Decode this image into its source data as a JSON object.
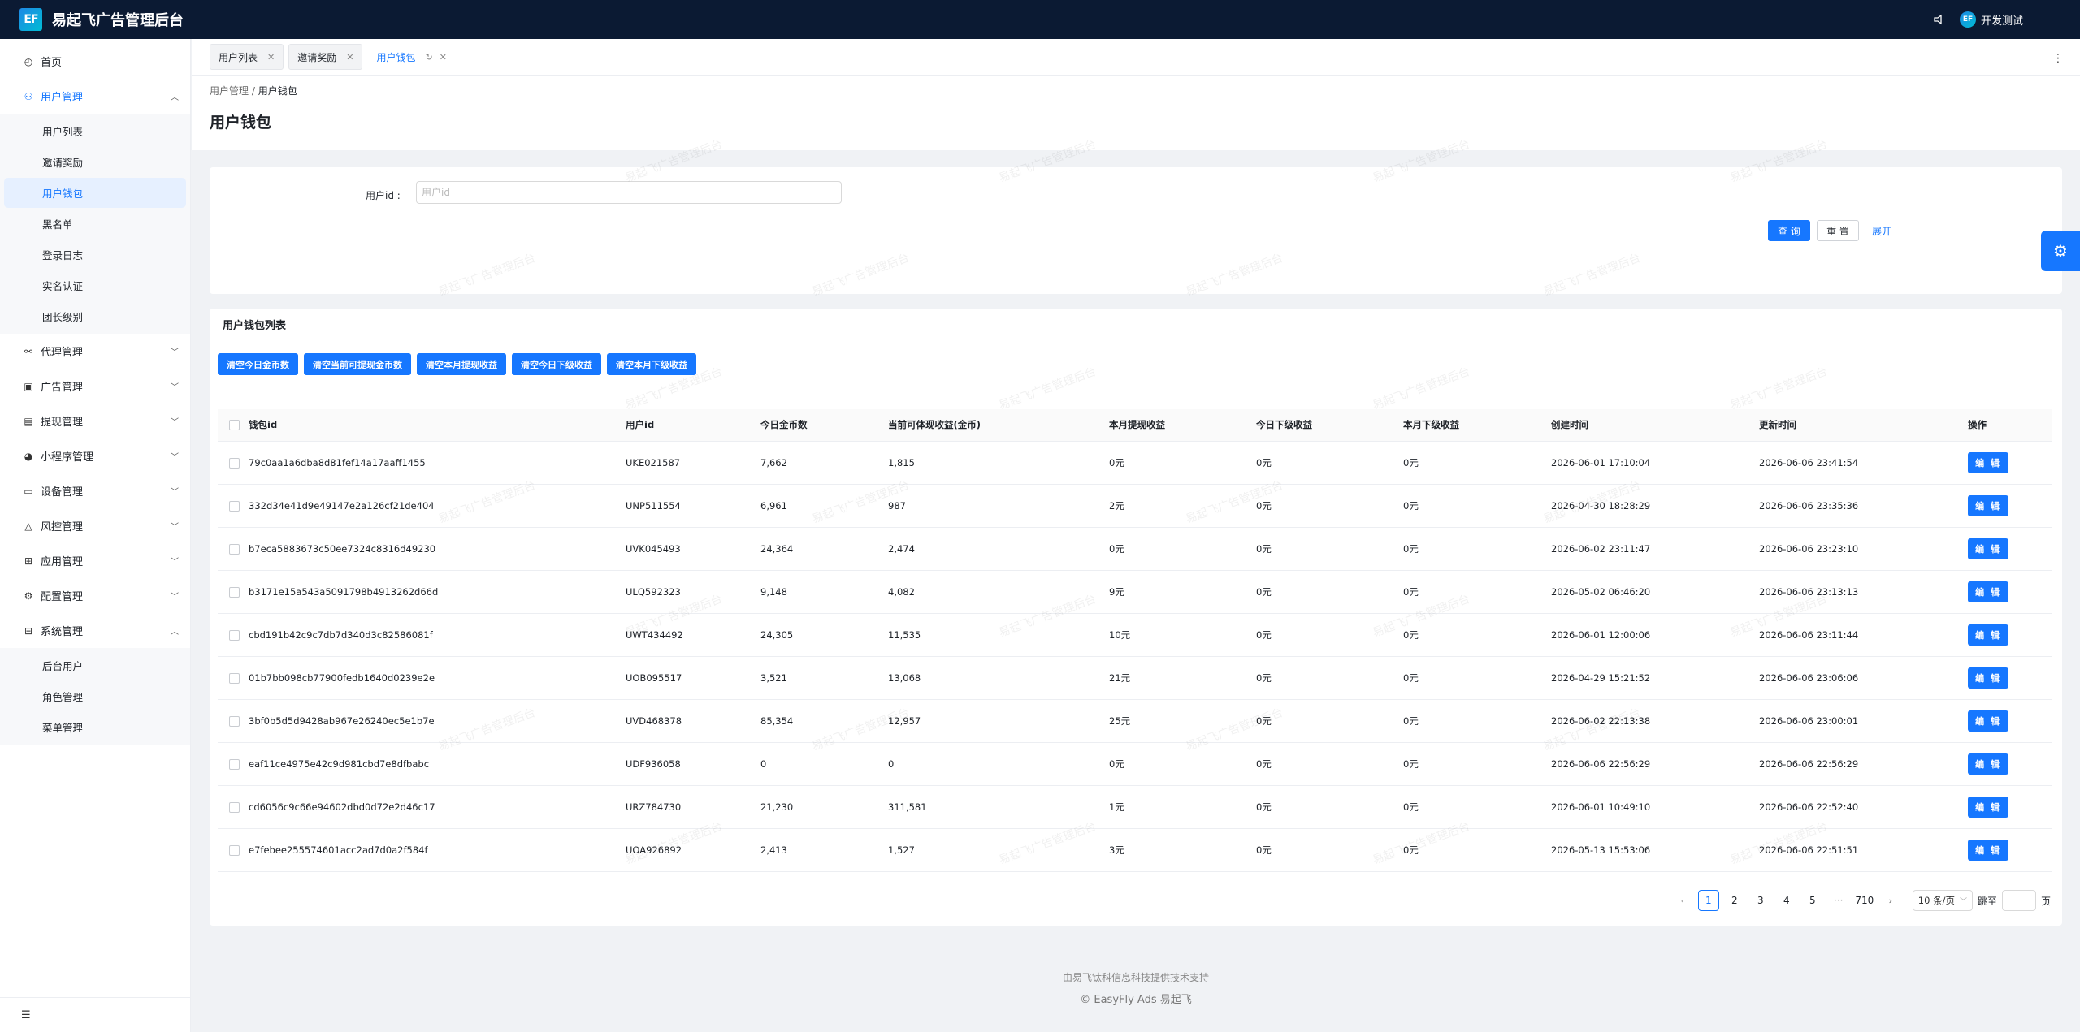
{
  "header": {
    "logo_text": "EF",
    "app_title": "易起飞广告管理后台",
    "user_avatar": "EF",
    "user_name": "开发测试"
  },
  "sidebar": {
    "home": "首页",
    "user_mgmt": "用户管理",
    "user_sub": [
      {
        "label": "用户列表",
        "active": false
      },
      {
        "label": "邀请奖励",
        "active": false
      },
      {
        "label": "用户钱包",
        "active": true
      },
      {
        "label": "黑名单",
        "active": false
      },
      {
        "label": "登录日志",
        "active": false
      },
      {
        "label": "实名认证",
        "active": false
      },
      {
        "label": "团长级别",
        "active": false
      }
    ],
    "groups": [
      {
        "label": "代理管理",
        "icon": "agent-icon"
      },
      {
        "label": "广告管理",
        "icon": "ad-icon"
      },
      {
        "label": "提现管理",
        "icon": "withdraw-icon"
      },
      {
        "label": "小程序管理",
        "icon": "miniapp-icon"
      },
      {
        "label": "设备管理",
        "icon": "device-icon"
      },
      {
        "label": "风控管理",
        "icon": "risk-icon"
      },
      {
        "label": "应用管理",
        "icon": "app-icon"
      },
      {
        "label": "配置管理",
        "icon": "config-icon"
      }
    ],
    "system_mgmt": "系统管理",
    "system_sub": [
      {
        "label": "后台用户"
      },
      {
        "label": "角色管理"
      },
      {
        "label": "菜单管理"
      }
    ]
  },
  "tabs": [
    {
      "label": "用户列表",
      "active": false
    },
    {
      "label": "邀请奖励",
      "active": false
    },
    {
      "label": "用户钱包",
      "active": true
    }
  ],
  "breadcrumb": {
    "parent": "用户管理",
    "sep": "/",
    "current": "用户钱包"
  },
  "page_title": "用户钱包",
  "search": {
    "label": "用户id :",
    "placeholder": "用户id",
    "query_label": "查 询",
    "reset_label": "重 置",
    "expand_label": "展开"
  },
  "table_card": {
    "title": "用户钱包列表",
    "actions": [
      "清空今日金币数",
      "清空当前可提现金币数",
      "清空本月提现收益",
      "清空今日下级收益",
      "清空本月下级收益"
    ],
    "columns": [
      "钱包id",
      "用户id",
      "今日金币数",
      "当前可体现收益(金币)",
      "本月提现收益",
      "今日下级收益",
      "本月下级收益",
      "创建时间",
      "更新时间",
      "操作"
    ],
    "edit_label": "编 辑",
    "rows": [
      {
        "wallet_id": "79c0aa1a6dba8d81fef14a17aaff1455",
        "user_id": "UKE021587",
        "coins_today": "7,662",
        "withdrawable": "1,815",
        "month_withdraw": "0元",
        "today_sub": "0元",
        "month_sub": "0元",
        "created": "2026-06-01 17:10:04",
        "updated": "2026-06-06 23:41:54"
      },
      {
        "wallet_id": "332d34e41d9e49147e2a126cf21de404",
        "user_id": "UNP511554",
        "coins_today": "6,961",
        "withdrawable": "987",
        "month_withdraw": "2元",
        "today_sub": "0元",
        "month_sub": "0元",
        "created": "2026-04-30 18:28:29",
        "updated": "2026-06-06 23:35:36"
      },
      {
        "wallet_id": "b7eca5883673c50ee7324c8316d49230",
        "user_id": "UVK045493",
        "coins_today": "24,364",
        "withdrawable": "2,474",
        "month_withdraw": "0元",
        "today_sub": "0元",
        "month_sub": "0元",
        "created": "2026-06-02 23:11:47",
        "updated": "2026-06-06 23:23:10"
      },
      {
        "wallet_id": "b3171e15a543a5091798b4913262d66d",
        "user_id": "ULQ592323",
        "coins_today": "9,148",
        "withdrawable": "4,082",
        "month_withdraw": "9元",
        "today_sub": "0元",
        "month_sub": "0元",
        "created": "2026-05-02 06:46:20",
        "updated": "2026-06-06 23:13:13"
      },
      {
        "wallet_id": "cbd191b42c9c7db7d340d3c82586081f",
        "user_id": "UWT434492",
        "coins_today": "24,305",
        "withdrawable": "11,535",
        "month_withdraw": "10元",
        "today_sub": "0元",
        "month_sub": "0元",
        "created": "2026-06-01 12:00:06",
        "updated": "2026-06-06 23:11:44"
      },
      {
        "wallet_id": "01b7bb098cb77900fedb1640d0239e2e",
        "user_id": "UOB095517",
        "coins_today": "3,521",
        "withdrawable": "13,068",
        "month_withdraw": "21元",
        "today_sub": "0元",
        "month_sub": "0元",
        "created": "2026-04-29 15:21:52",
        "updated": "2026-06-06 23:06:06"
      },
      {
        "wallet_id": "3bf0b5d5d9428ab967e26240ec5e1b7e",
        "user_id": "UVD468378",
        "coins_today": "85,354",
        "withdrawable": "12,957",
        "month_withdraw": "25元",
        "today_sub": "0元",
        "month_sub": "0元",
        "created": "2026-06-02 22:13:38",
        "updated": "2026-06-06 23:00:01"
      },
      {
        "wallet_id": "eaf11ce4975e42c9d981cbd7e8dfbabc",
        "user_id": "UDF936058",
        "coins_today": "0",
        "withdrawable": "0",
        "month_withdraw": "0元",
        "today_sub": "0元",
        "month_sub": "0元",
        "created": "2026-06-06 22:56:29",
        "updated": "2026-06-06 22:56:29"
      },
      {
        "wallet_id": "cd6056c9c66e94602dbd0d72e2d46c17",
        "user_id": "URZ784730",
        "coins_today": "21,230",
        "withdrawable": "311,581",
        "month_withdraw": "1元",
        "today_sub": "0元",
        "month_sub": "0元",
        "created": "2026-06-01 10:49:10",
        "updated": "2026-06-06 22:52:40"
      },
      {
        "wallet_id": "e7febee255574601acc2ad7d0a2f584f",
        "user_id": "UOA926892",
        "coins_today": "2,413",
        "withdrawable": "1,527",
        "month_withdraw": "3元",
        "today_sub": "0元",
        "month_sub": "0元",
        "created": "2026-05-13 15:53:06",
        "updated": "2026-06-06 22:51:51"
      }
    ]
  },
  "pagination": {
    "pages": [
      "1",
      "2",
      "3",
      "4",
      "5",
      "···",
      "710"
    ],
    "current": "1",
    "page_size": "10 条/页",
    "jump_label": "跳至",
    "page_suffix": "页"
  },
  "footer": {
    "line1": "由易飞钛科信息科技提供技术支持",
    "line2": "© EasyFly Ads 易起飞"
  },
  "watermark_text": "易起飞广告管理后台"
}
